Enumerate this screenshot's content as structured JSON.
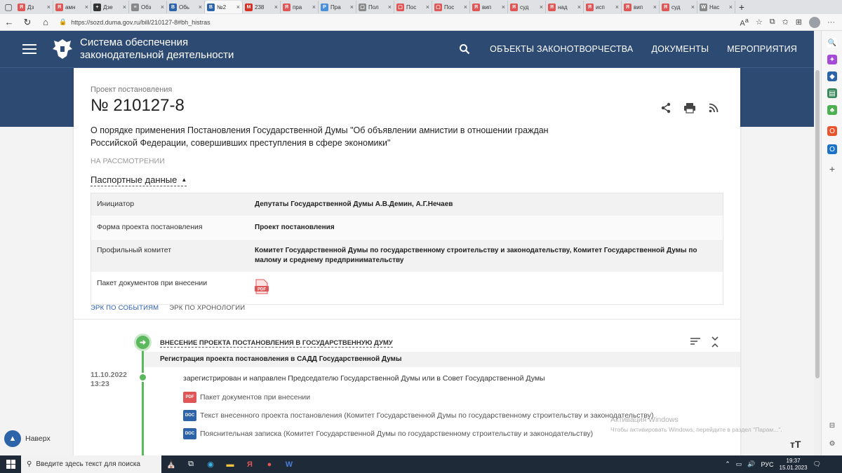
{
  "browser": {
    "tabs": [
      {
        "label": "Дз",
        "color": "#e05555",
        "glyph": "Я"
      },
      {
        "label": "амн",
        "color": "#e05555",
        "glyph": "Я"
      },
      {
        "label": "Дзе",
        "color": "#333333",
        "glyph": "+"
      },
      {
        "label": "Обз",
        "color": "#888888",
        "glyph": "≡"
      },
      {
        "label": "Обь",
        "color": "#2d63a8",
        "glyph": "B"
      },
      {
        "label": "№2",
        "color": "#2d63a8",
        "glyph": "B",
        "active": true
      },
      {
        "label": "238",
        "color": "#d93025",
        "glyph": "М"
      },
      {
        "label": "пра",
        "color": "#e05555",
        "glyph": "Я"
      },
      {
        "label": "Пра",
        "color": "#4a90d9",
        "glyph": "P"
      },
      {
        "label": "Пол",
        "color": "#888888",
        "glyph": "▢"
      },
      {
        "label": "Пос",
        "color": "#e05555",
        "glyph": "▢"
      },
      {
        "label": "Пос",
        "color": "#e05555",
        "glyph": "▢"
      },
      {
        "label": "вип",
        "color": "#e05555",
        "glyph": "Я"
      },
      {
        "label": "суд",
        "color": "#e05555",
        "glyph": "Я"
      },
      {
        "label": "над",
        "color": "#e05555",
        "glyph": "Я"
      },
      {
        "label": "исп",
        "color": "#e05555",
        "glyph": "Я"
      },
      {
        "label": "вип",
        "color": "#e05555",
        "glyph": "Я"
      },
      {
        "label": "суд",
        "color": "#e05555",
        "glyph": "Я"
      },
      {
        "label": "Нас",
        "color": "#888888",
        "glyph": "W"
      }
    ],
    "url": "https://sozd.duma.gov.ru/bill/210127-8#bh_histras"
  },
  "site": {
    "title": "Система обеспечения законодательной деятельности",
    "nav": [
      "ОБЪЕКТЫ ЗАКОНОТВОРЧЕСТВА",
      "ДОКУМЕНТЫ",
      "МЕРОПРИЯТИЯ"
    ]
  },
  "bill": {
    "kind": "Проект постановления",
    "number": "№ 210127-8",
    "title": "О порядке применения Постановления Государственной Думы \"Об объявлении амнистии в отношении граждан Российской Федерации, совершивших преступления в сфере экономики\"",
    "status": "НА РАССМОТРЕНИИ",
    "passport_label": "Паспортные данные",
    "passport": [
      {
        "key": "Инициатор",
        "value": "Депутаты Государственной Думы А.В.Демин, А.Г.Нечаев"
      },
      {
        "key": "Форма проекта постановления",
        "value": "Проект постановления"
      },
      {
        "key": "Профильный комитет",
        "value": "Комитет Государственной Думы по государственному строительству и законодательству, Комитет Государственной Думы по малому и среднему предпринимательству"
      },
      {
        "key": "Пакет документов при внесении",
        "value": "",
        "icon": "pdf"
      }
    ]
  },
  "tabs": {
    "events": "ЭРК ПО СОБЫТИЯМ",
    "chronology": "ЭРК ПО ХРОНОЛОГИИ"
  },
  "timeline": {
    "stage": "ВНЕСЕНИЕ ПРОЕКТА ПОСТАНОВЛЕНИЯ В ГОСУДАРСТВЕННУЮ ДУМУ",
    "substage": "Регистрация проекта постановления в САДД Государственной Думы",
    "date": "11.10.2022",
    "time": "13:23",
    "event": "зарегистрирован и направлен Председателю Государственной Думы или в Совет Государственной Думы",
    "documents": [
      {
        "type": "PDF",
        "label": "Пакет документов при внесении"
      },
      {
        "type": "DOC",
        "label": "Текст внесенного проекта постановления (Комитет Государственной Думы по государственному строительству и законодательству)"
      },
      {
        "type": "DOC",
        "label": "Пояснительная записка (Комитет Государственной Думы по государственному строительству и законодательству)"
      }
    ]
  },
  "back_label": "Наверх",
  "watermark": {
    "line1": "Активация Windows",
    "line2": "Чтобы активировать Windows, перейдите в раздел \"Парам...\"."
  },
  "taskbar": {
    "search_placeholder": "Введите здесь текст для поиска",
    "lang": "РУС",
    "time": "19:37",
    "date": "15.01.2023"
  }
}
